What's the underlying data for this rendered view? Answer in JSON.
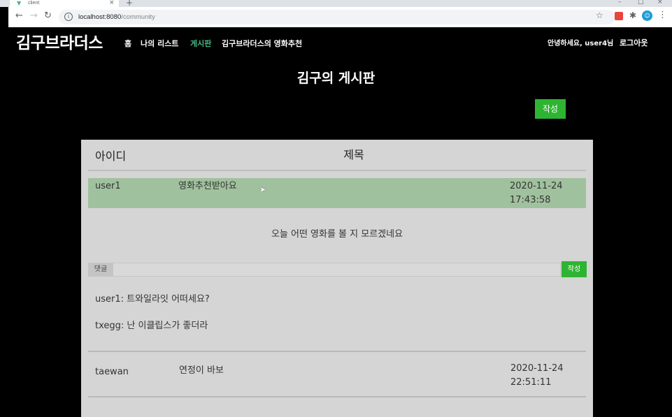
{
  "browser": {
    "tab_title": "client",
    "url_host": "localhost:8080",
    "url_path": "/community"
  },
  "site": {
    "brand": "김구브라더스",
    "nav": {
      "home": "홈",
      "my_list": "나의 리스트",
      "board": "게시판",
      "recommend": "김구브라더스의 영화추천"
    },
    "greeting": "안녕하세요, user4님",
    "logout": "로그아웃"
  },
  "page": {
    "title": "김구의 게시판",
    "write_button": "작성"
  },
  "board": {
    "columns": {
      "id": "아이디",
      "title": "제목"
    },
    "rows": [
      {
        "author": "user1",
        "subject": "영화추천받아요",
        "date": "2020-11-24",
        "time": "17:43:58",
        "selected": true
      },
      {
        "author": "taewan",
        "subject": "연정이 바보",
        "date": "2020-11-24",
        "time": "22:51:11",
        "selected": false
      }
    ],
    "detail": {
      "body": "오늘 어떤 영화를 볼 지 모르겠네요",
      "comment_label": "댓글",
      "comment_value": "",
      "comment_submit": "작성",
      "comments": [
        "user1: 트와일라잇 어떠세요?",
        "txegg: 난 이클립스가 좋더라"
      ]
    }
  },
  "colors": {
    "accent_green": "#2eb432",
    "active_nav": "#42b983",
    "selected_row": "#a0c19d",
    "panel": "#d5d5d5"
  }
}
